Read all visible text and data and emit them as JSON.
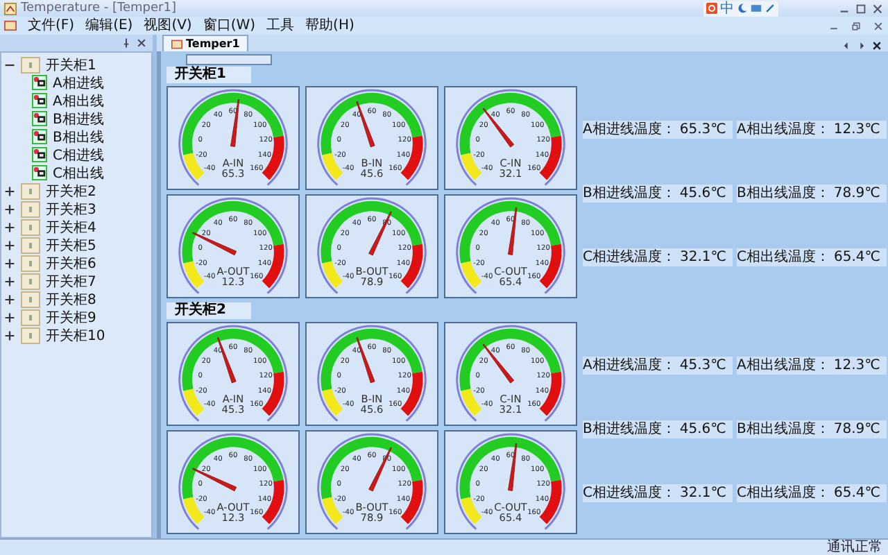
{
  "window": {
    "title": "Temperature - [Temper1]",
    "ime": "中"
  },
  "menu": [
    "文件(F)",
    "编辑(E)",
    "视图(V)",
    "窗口(W)",
    "工具",
    "帮助(H)"
  ],
  "tabs": [
    {
      "label": "Temper1",
      "selected": true
    }
  ],
  "tree": [
    {
      "label": "开关柜1",
      "expanded": true,
      "children": [
        {
          "label": "A相进线"
        },
        {
          "label": "A相出线"
        },
        {
          "label": "B相进线"
        },
        {
          "label": "B相出线"
        },
        {
          "label": "C相进线"
        },
        {
          "label": "C相出线"
        }
      ]
    },
    {
      "label": "开关柜2",
      "expanded": false
    },
    {
      "label": "开关柜3",
      "expanded": false
    },
    {
      "label": "开关柜4",
      "expanded": false
    },
    {
      "label": "开关柜5",
      "expanded": false
    },
    {
      "label": "开关柜6",
      "expanded": false
    },
    {
      "label": "开关柜7",
      "expanded": false
    },
    {
      "label": "开关柜8",
      "expanded": false
    },
    {
      "label": "开关柜9",
      "expanded": false
    },
    {
      "label": "开关柜10",
      "expanded": false
    }
  ],
  "sections": [
    {
      "title": "开关柜1",
      "gauges": [
        {
          "scale": [
            "60",
            "40",
            "80",
            "20",
            "100",
            "0",
            "120",
            "-20",
            "140",
            "-40",
            "160"
          ],
          "name": "A-IN",
          "value": "65.3",
          "level": 0.5265
        },
        {
          "scale": [
            "60",
            "40",
            "80",
            "20",
            "100",
            "0",
            "120",
            "-20",
            "140",
            "-40",
            "160"
          ],
          "name": "B-IN",
          "value": "45.6",
          "level": 0.428
        },
        {
          "scale": [
            "60",
            "40",
            "80",
            "20",
            "100",
            "0",
            "120",
            "-20",
            "140",
            "-40",
            "160"
          ],
          "name": "C-IN",
          "value": "32.1",
          "level": 0.3605
        },
        {
          "scale": [
            "60",
            "40",
            "80",
            "20",
            "100",
            "0",
            "120",
            "-20",
            "140",
            "-40",
            "160"
          ],
          "name": "A-OUT",
          "value": "12.3",
          "level": 0.2615
        },
        {
          "scale": [
            "60",
            "40",
            "80",
            "20",
            "100",
            "0",
            "120",
            "-20",
            "140",
            "-40",
            "160"
          ],
          "name": "B-OUT",
          "value": "78.9",
          "level": 0.5945
        },
        {
          "scale": [
            "60",
            "40",
            "80",
            "20",
            "100",
            "0",
            "120",
            "-20",
            "140",
            "-40",
            "160"
          ],
          "name": "C-OUT",
          "value": "65.4",
          "level": 0.527
        }
      ],
      "readings": [
        {
          "label": "A相进线温度：",
          "value": "65.3℃"
        },
        {
          "label": "A相出线温度：",
          "value": "12.3℃"
        },
        {
          "label": "B相进线温度：",
          "value": "45.6℃"
        },
        {
          "label": "B相出线温度：",
          "value": "78.9℃"
        },
        {
          "label": "C相进线温度：",
          "value": "32.1℃"
        },
        {
          "label": "C相出线温度：",
          "value": "65.4℃"
        }
      ]
    },
    {
      "title": "开关柜2",
      "gauges": [
        {
          "scale": [
            "60",
            "40",
            "80",
            "20",
            "100",
            "0",
            "120",
            "-20",
            "140",
            "-40",
            "160"
          ],
          "name": "A-IN",
          "value": "45.3",
          "level": 0.4265
        },
        {
          "scale": [
            "60",
            "40",
            "80",
            "20",
            "100",
            "0",
            "120",
            "-20",
            "140",
            "-40",
            "160"
          ],
          "name": "B-IN",
          "value": "45.6",
          "level": 0.428
        },
        {
          "scale": [
            "60",
            "40",
            "80",
            "20",
            "100",
            "0",
            "120",
            "-20",
            "140",
            "-40",
            "160"
          ],
          "name": "C-IN",
          "value": "32.1",
          "level": 0.3605
        },
        {
          "scale": [
            "60",
            "40",
            "80",
            "20",
            "100",
            "0",
            "120",
            "-20",
            "140",
            "-40",
            "160"
          ],
          "name": "A-OUT",
          "value": "12.3",
          "level": 0.2615
        },
        {
          "scale": [
            "60",
            "40",
            "80",
            "20",
            "100",
            "0",
            "120",
            "-20",
            "140",
            "-40",
            "160"
          ],
          "name": "B-OUT",
          "value": "78.9",
          "level": 0.5945
        },
        {
          "scale": [
            "60",
            "40",
            "80",
            "20",
            "100",
            "0",
            "120",
            "-20",
            "140",
            "-40",
            "160"
          ],
          "name": "C-OUT",
          "value": "65.4",
          "level": 0.527
        }
      ],
      "readings": [
        {
          "label": "A相进线温度：",
          "value": "45.3℃"
        },
        {
          "label": "A相出线温度：",
          "value": "12.3℃"
        },
        {
          "label": "B相进线温度：",
          "value": "45.6℃"
        },
        {
          "label": "B相出线温度：",
          "value": "78.9℃"
        },
        {
          "label": "C相进线温度：",
          "value": "32.1℃"
        },
        {
          "label": "C相出线温度：",
          "value": "65.4℃"
        }
      ]
    }
  ],
  "status_bar": {
    "text": "通讯正常"
  }
}
